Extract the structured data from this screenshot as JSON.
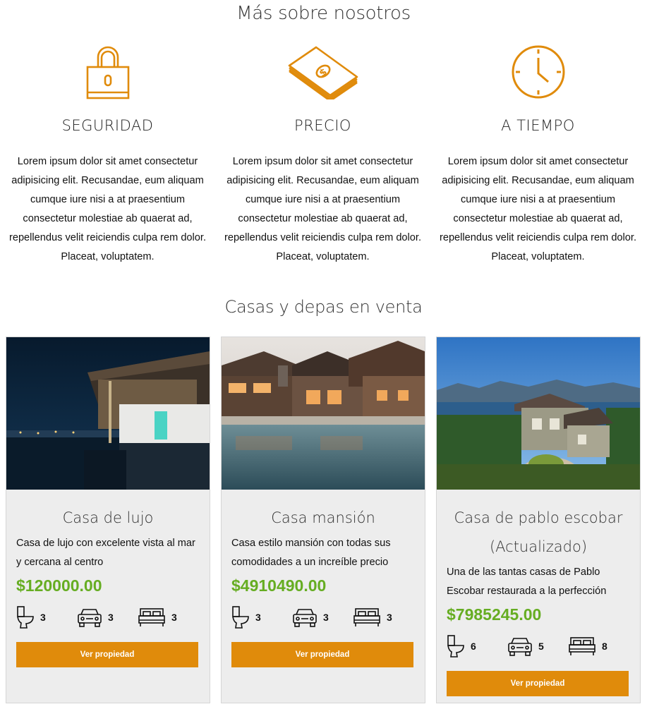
{
  "about": {
    "title": "Más sobre nosotros",
    "features": [
      {
        "icon": "padlock-icon",
        "title": "SEGURIDAD",
        "text": "Lorem ipsum dolor sit amet consectetur adipisicing elit. Recusandae, eum aliquam cumque iure nisi a at praesentium consectetur molestiae ab quaerat ad, repellendus velit reiciendis culpa rem dolor. Placeat, voluptatem."
      },
      {
        "icon": "money-stack-icon",
        "title": "PRECIO",
        "text": "Lorem ipsum dolor sit amet consectetur adipisicing elit. Recusandae, eum aliquam cumque iure nisi a at praesentium consectetur molestiae ab quaerat ad, repellendus velit reiciendis culpa rem dolor. Placeat, voluptatem."
      },
      {
        "icon": "clock-icon",
        "title": "A TIEMPO",
        "text": "Lorem ipsum dolor sit amet consectetur adipisicing elit. Recusandae, eum aliquam cumque iure nisi a at praesentium consectetur molestiae ab quaerat ad, repellendus velit reiciendis culpa rem dolor. Placeat, voluptatem."
      }
    ],
    "icon_color": "#e08b0b"
  },
  "listings": {
    "title": "Casas y depas en venta",
    "button_label": "Ver propiedad",
    "button_color": "#e08b0b",
    "price_color": "#66ad22",
    "cards": [
      {
        "title": "Casa de lujo",
        "description": "Casa de lujo con excelente vista al mar y cercana al centro",
        "price": "$120000.00",
        "bathrooms": "3",
        "parking": "3",
        "bedrooms": "3"
      },
      {
        "title": "Casa mansión",
        "description": "Casa estilo mansión con todas sus comodidades a un increíble precio",
        "price": "$4910490.00",
        "bathrooms": "3",
        "parking": "3",
        "bedrooms": "3"
      },
      {
        "title": "Casa de pablo escobar (Actualizado)",
        "description": "Una de las tantas casas de Pablo Escobar restaurada a la perfección",
        "price": "$7985245.00",
        "bathrooms": "6",
        "parking": "5",
        "bedrooms": "8"
      }
    ]
  }
}
